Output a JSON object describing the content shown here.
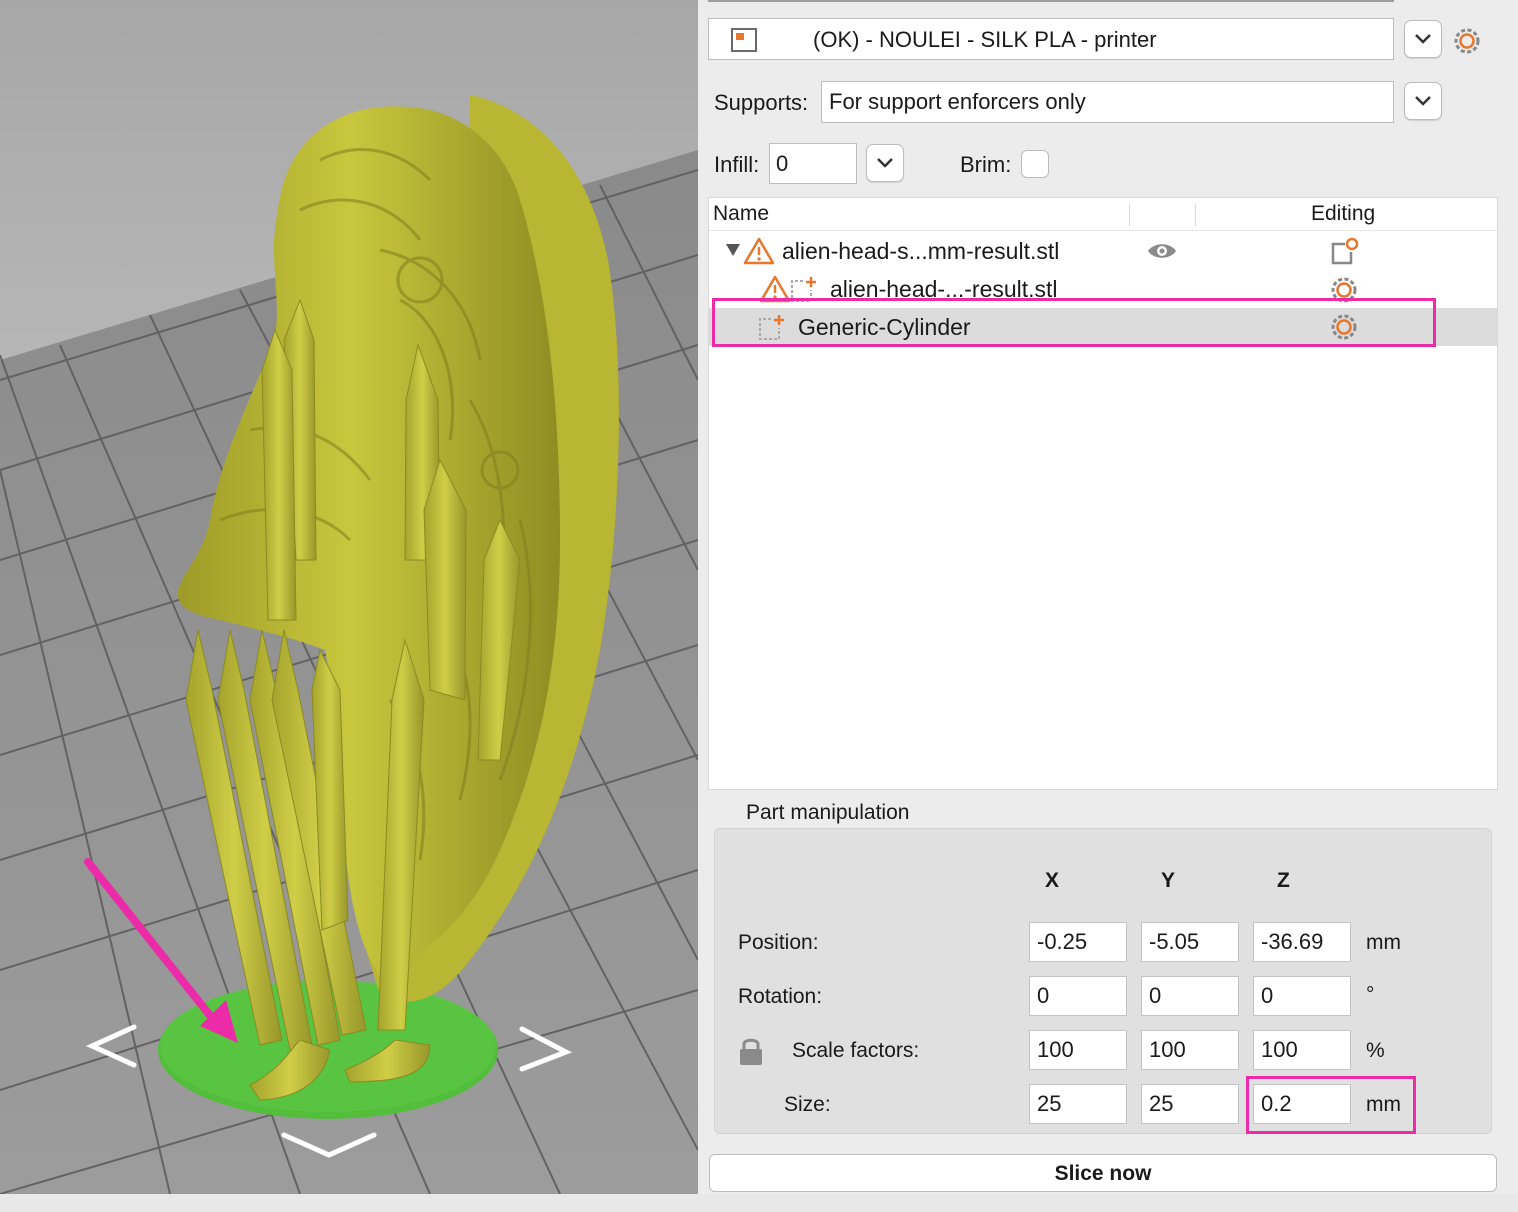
{
  "preset": {
    "value": "(OK) - NOULEI - SILK PLA - printer"
  },
  "supports": {
    "label": "Supports:",
    "value": "For support enforcers only"
  },
  "infill": {
    "label": "Infill:",
    "value": "0"
  },
  "brim": {
    "label": "Brim:",
    "checked": false
  },
  "object_list": {
    "columns": {
      "name": "Name",
      "editing": "Editing"
    },
    "rows": [
      {
        "name": "alien-head-s...mm-result.stl",
        "level": 0,
        "warning": true,
        "visible_icon": "eye-icon",
        "editing_icon": "add-settings-icon"
      },
      {
        "name": "alien-head-...-result.stl",
        "level": 1,
        "warning": true,
        "editing_icon": "gear-icon"
      },
      {
        "name": "Generic-Cylinder",
        "level": 1,
        "warning": false,
        "selected": true,
        "editing_icon": "gear-icon"
      }
    ]
  },
  "part_manipulation": {
    "title": "Part manipulation",
    "axes": [
      "X",
      "Y",
      "Z"
    ],
    "position": {
      "label": "Position:",
      "x": "-0.25",
      "y": "-5.05",
      "z": "-36.69",
      "unit": "mm"
    },
    "rotation": {
      "label": "Rotation:",
      "x": "0",
      "y": "0",
      "z": "0",
      "unit": "°"
    },
    "scale": {
      "label": "Scale factors:",
      "x": "100",
      "y": "100",
      "z": "100",
      "unit": "%"
    },
    "size": {
      "label": "Size:",
      "x": "25",
      "y": "25",
      "z": "0.2",
      "unit": "mm"
    }
  },
  "slice_button": {
    "label": "Slice now"
  },
  "colors": {
    "accent_orange": "#e8772e",
    "highlight_magenta": "#ec2ba8",
    "model_yellow": "#b7b531",
    "cylinder_green": "#53bd3c",
    "bed_gray": "#9a9a9a"
  },
  "viewport": {
    "nav_arrows": [
      "<",
      ">",
      "v"
    ]
  }
}
